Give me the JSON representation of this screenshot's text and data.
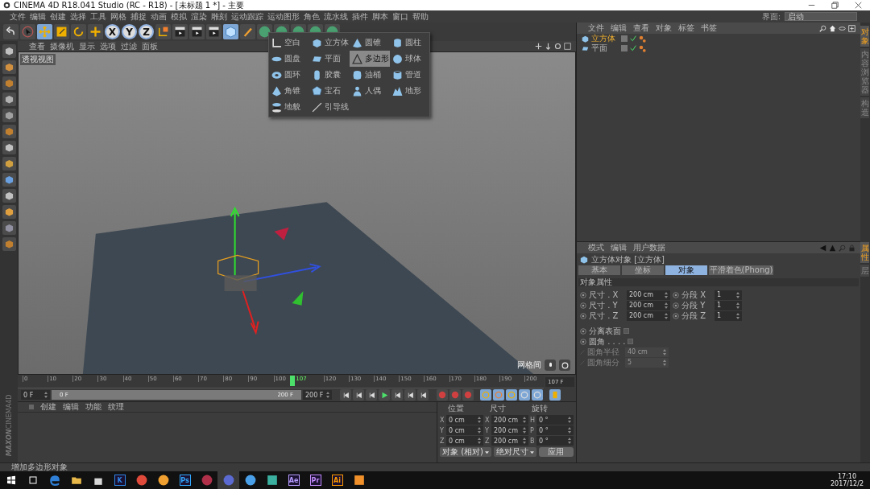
{
  "window": {
    "title": "CINEMA 4D R18.041 Studio (RC - R18) - [未标题 1 *] - 主要"
  },
  "menu_bar": [
    "文件",
    "编辑",
    "创建",
    "选择",
    "工具",
    "网格",
    "捕捉",
    "动画",
    "模拟",
    "渲染",
    "雕刻",
    "运动跟踪",
    "运动图形",
    "角色",
    "流水线",
    "插件",
    "脚本",
    "窗口",
    "帮助"
  ],
  "layout_selector": {
    "label": "界面:",
    "value": "启动"
  },
  "toolbar": [
    {
      "kind": "undo",
      "on": false
    },
    {
      "kind": "select",
      "on": false
    },
    {
      "kind": "move",
      "on": true
    },
    {
      "kind": "scale",
      "on": false
    },
    {
      "kind": "rotate",
      "on": false
    },
    {
      "kind": "add",
      "on": false
    },
    {
      "kind": "axis",
      "label": "X",
      "on": true
    },
    {
      "kind": "axis",
      "label": "Y",
      "on": true
    },
    {
      "kind": "axis",
      "label": "Z",
      "on": true
    },
    {
      "kind": "coords",
      "on": false
    },
    {
      "kind": "render",
      "on": false
    },
    {
      "kind": "render",
      "on": false
    },
    {
      "kind": "render",
      "on": false
    },
    {
      "kind": "cube",
      "on": true
    },
    {
      "kind": "pen",
      "on": false
    },
    {
      "kind": "blob",
      "on": false
    },
    {
      "kind": "blob",
      "on": false
    },
    {
      "kind": "blob",
      "on": false
    },
    {
      "kind": "blob",
      "on": false
    },
    {
      "kind": "blob",
      "on": false
    }
  ],
  "object_popup": [
    {
      "label": "空白",
      "selected": false
    },
    {
      "label": "立方体",
      "selected": false
    },
    {
      "label": "圆锥",
      "selected": false
    },
    {
      "label": "圆柱",
      "selected": false
    },
    {
      "label": "圆盘",
      "selected": false
    },
    {
      "label": "平面",
      "selected": false
    },
    {
      "label": "多边形",
      "selected": true
    },
    {
      "label": "球体",
      "selected": false
    },
    {
      "label": "圆环",
      "selected": false
    },
    {
      "label": "胶囊",
      "selected": false
    },
    {
      "label": "油桶",
      "selected": false
    },
    {
      "label": "管道",
      "selected": false
    },
    {
      "label": "角锥",
      "selected": false
    },
    {
      "label": "宝石",
      "selected": false
    },
    {
      "label": "人偶",
      "selected": false
    },
    {
      "label": "地形",
      "selected": false
    },
    {
      "label": "地貌",
      "selected": false
    },
    {
      "label": "引导线",
      "selected": false
    }
  ],
  "viewport": {
    "menu": [
      "查看",
      "摄像机",
      "显示",
      "选项",
      "过滤",
      "面板"
    ],
    "view_name": "透视视图",
    "hud_label": "网格间"
  },
  "timeline": {
    "ticks": [
      "0",
      "10",
      "20",
      "30",
      "40",
      "50",
      "60",
      "70",
      "80",
      "90",
      "100"
    ],
    "ticks_after_playhead": [
      "120",
      "130",
      "140",
      "150",
      "160",
      "170",
      "180",
      "190",
      "200"
    ],
    "current": "107",
    "level": 0.535,
    "frame_field": "107 F"
  },
  "transport": {
    "start": "0 F",
    "range": {
      "start": "0 F",
      "end": "200 F",
      "level": 1
    },
    "end": "200 F"
  },
  "brand": {
    "maker": "MAXON",
    "product": "CINEMA4D"
  },
  "materials": {
    "menu": [
      "创建",
      "编辑",
      "功能",
      "纹理"
    ]
  },
  "coordinates": {
    "headers": [
      "位置",
      "尺寸",
      "旋转"
    ],
    "rows": [
      {
        "axis": "X",
        "position": "0 cm",
        "size_axis": "X",
        "size": "200 cm",
        "rot_axis": "H",
        "rotation": "0 °"
      },
      {
        "axis": "Y",
        "position": "0 cm",
        "size_axis": "Y",
        "size": "200 cm",
        "rot_axis": "P",
        "rotation": "0 °"
      },
      {
        "axis": "Z",
        "position": "0 cm",
        "size_axis": "Z",
        "size": "200 cm",
        "rot_axis": "B",
        "rotation": "0 °"
      }
    ],
    "dropdowns": [
      "对象 (相对)",
      "绝对尺寸"
    ],
    "apply": "应用"
  },
  "status_bar": "增加多边形对象",
  "object_manager": {
    "menu": [
      "文件",
      "编辑",
      "查看",
      "对象",
      "标签",
      "书签"
    ],
    "objects": [
      {
        "name": "立方体",
        "selected": true
      },
      {
        "name": "平面",
        "selected": false
      }
    ]
  },
  "attribute_manager": {
    "menu": [
      "模式",
      "编辑",
      "用户数据"
    ],
    "object_title": "立方体对象 [立方体]",
    "tabs": [
      {
        "label": "基本",
        "selected": false
      },
      {
        "label": "坐标",
        "selected": false
      },
      {
        "label": "对象",
        "selected": true
      },
      {
        "label": "平滑着色(Phong)",
        "selected": false
      }
    ],
    "section": "对象属性",
    "sizes": [
      {
        "label": "尺寸 . X",
        "value": "200 cm"
      },
      {
        "label": "尺寸 . Y",
        "value": "200 cm"
      },
      {
        "label": "尺寸 . Z",
        "value": "200 cm"
      }
    ],
    "segments": [
      {
        "label": "分段 X",
        "value": "1"
      },
      {
        "label": "分段 Y",
        "value": "1"
      },
      {
        "label": "分段 Z",
        "value": "1"
      }
    ],
    "options": [
      {
        "label": "分离表面",
        "checked": false
      },
      {
        "label": "圆角 . . . .",
        "checked": false
      }
    ],
    "fillet": [
      {
        "label": "圆角半径",
        "value": "40 cm",
        "disabled": true
      },
      {
        "label": "圆角细分",
        "value": "5",
        "disabled": true
      }
    ]
  },
  "side_tabs": [
    {
      "label": "对象",
      "selected": true
    },
    {
      "label": "内容浏览器",
      "selected": false
    },
    {
      "label": "构造",
      "selected": false
    }
  ],
  "side_tabs_lower": [
    {
      "label": "属性",
      "selected": true
    },
    {
      "label": "层",
      "selected": false
    }
  ],
  "taskbar": {
    "apps": [
      {
        "kind": "edge",
        "color": "#2f7fd6",
        "selected": false
      },
      {
        "kind": "folder",
        "color": "#e8b84a",
        "selected": false
      },
      {
        "kind": "store",
        "color": "#d8d8d8",
        "selected": false
      },
      {
        "kind": "letter",
        "label": "K",
        "color": "#2f86e8",
        "selected": false
      },
      {
        "kind": "round",
        "color": "#e04a3a",
        "selected": false
      },
      {
        "kind": "round",
        "color": "#f0a030",
        "selected": false
      },
      {
        "kind": "letter",
        "label": "Ps",
        "color": "#31a8ff",
        "selected": false
      },
      {
        "kind": "round",
        "color": "#b0304a",
        "selected": false
      },
      {
        "kind": "round",
        "color": "#5a6ad0",
        "selected": true
      },
      {
        "kind": "round",
        "color": "#4aa0e8",
        "selected": false
      },
      {
        "kind": "square",
        "color": "#3bb0a0",
        "selected": false
      },
      {
        "kind": "letter",
        "label": "Ae",
        "color": "#b69cff",
        "selected": false
      },
      {
        "kind": "letter",
        "label": "Pr",
        "color": "#c58cff",
        "selected": false
      },
      {
        "kind": "letter",
        "label": "Ai",
        "color": "#ff9a00",
        "selected": false
      },
      {
        "kind": "square",
        "color": "#f0902a",
        "selected": false
      }
    ],
    "time": "17:10",
    "date": "2017/12/2"
  }
}
